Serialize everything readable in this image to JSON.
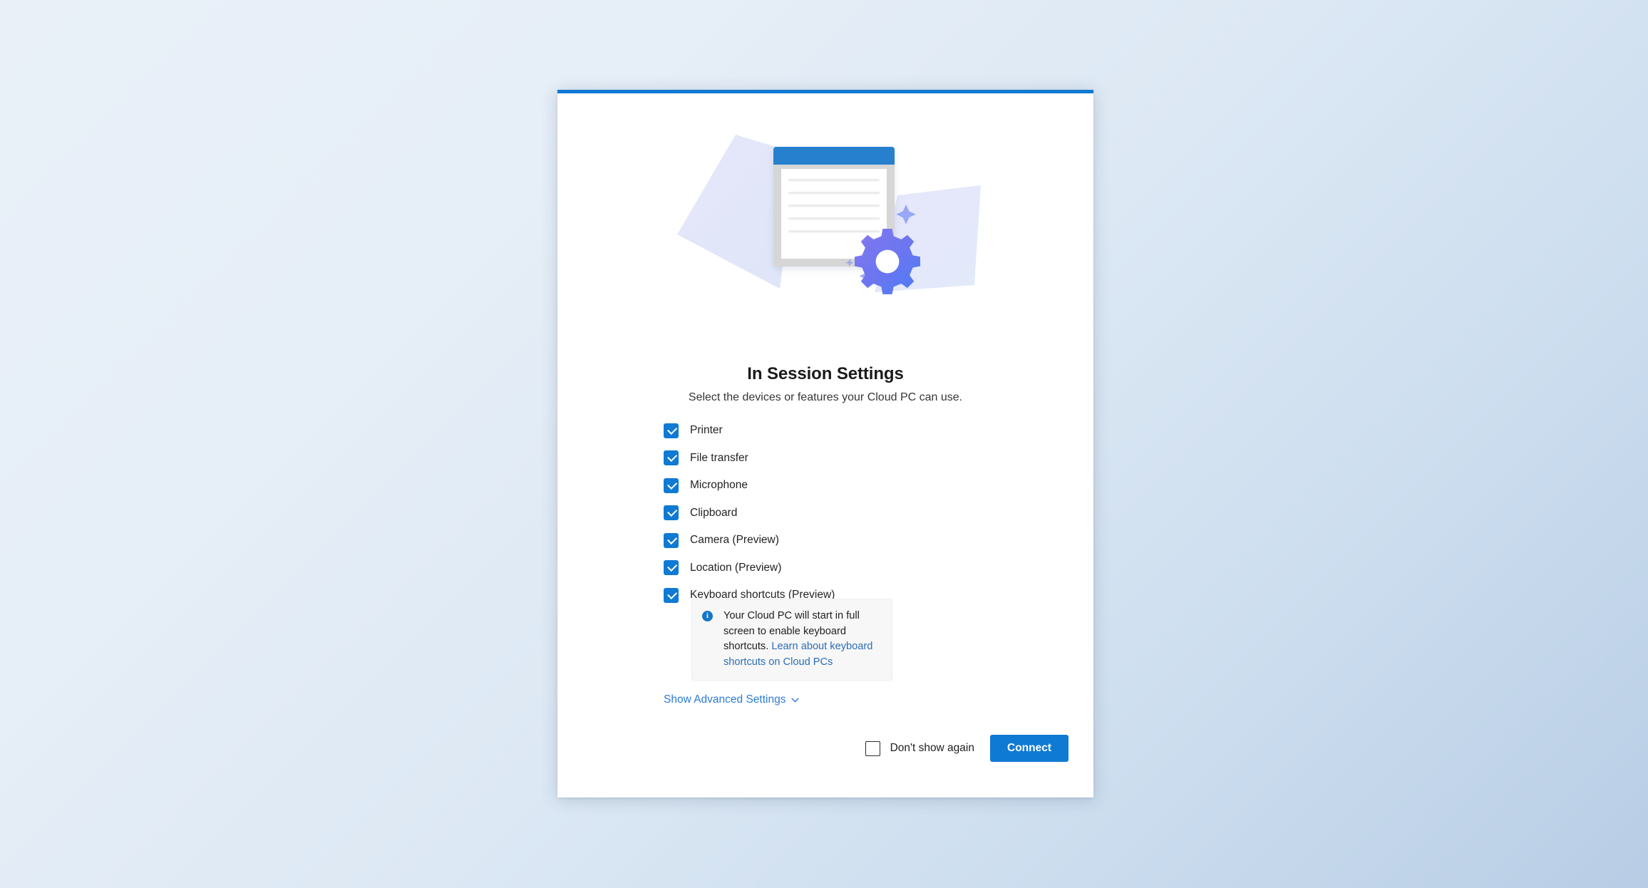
{
  "dialog": {
    "accent_color": "#0f7ad4",
    "title": "In Session Settings",
    "subtitle": "Select the devices or features your Cloud PC can use."
  },
  "illustration": {
    "name": "in-session-settings-illustration",
    "window_titlebar_color": "#2580ce",
    "window_frame_color": "#d4d4d4",
    "shape_color": "#e3e5f8",
    "gear_gradient_from": "#7b72e8",
    "gear_gradient_to": "#4d7ff5",
    "document_line_color": "#ebebeb"
  },
  "options": [
    {
      "label": "Printer",
      "checked": true
    },
    {
      "label": "File transfer",
      "checked": true
    },
    {
      "label": "Microphone",
      "checked": true
    },
    {
      "label": "Clipboard",
      "checked": true
    },
    {
      "label": "Camera (Preview)",
      "checked": true
    },
    {
      "label": "Location (Preview)",
      "checked": true
    },
    {
      "label": "Keyboard shortcuts (Preview)",
      "checked": true
    }
  ],
  "info": {
    "icon": "info-circle-icon",
    "text": "Your Cloud PC will start in full screen to enable keyboard shortcuts. ",
    "link_text": "Learn about keyboard shortcuts on Cloud PCs",
    "link_color": "#2b6cb8",
    "background": "#f7f7f7"
  },
  "advanced": {
    "label": "Show Advanced Settings",
    "icon": "chevron-down-icon",
    "color": "#2b7cd3"
  },
  "footer": {
    "dont_show_again_label": "Don't show again",
    "dont_show_again_checked": false,
    "connect_label": "Connect",
    "connect_color": "#0f7ad4"
  }
}
